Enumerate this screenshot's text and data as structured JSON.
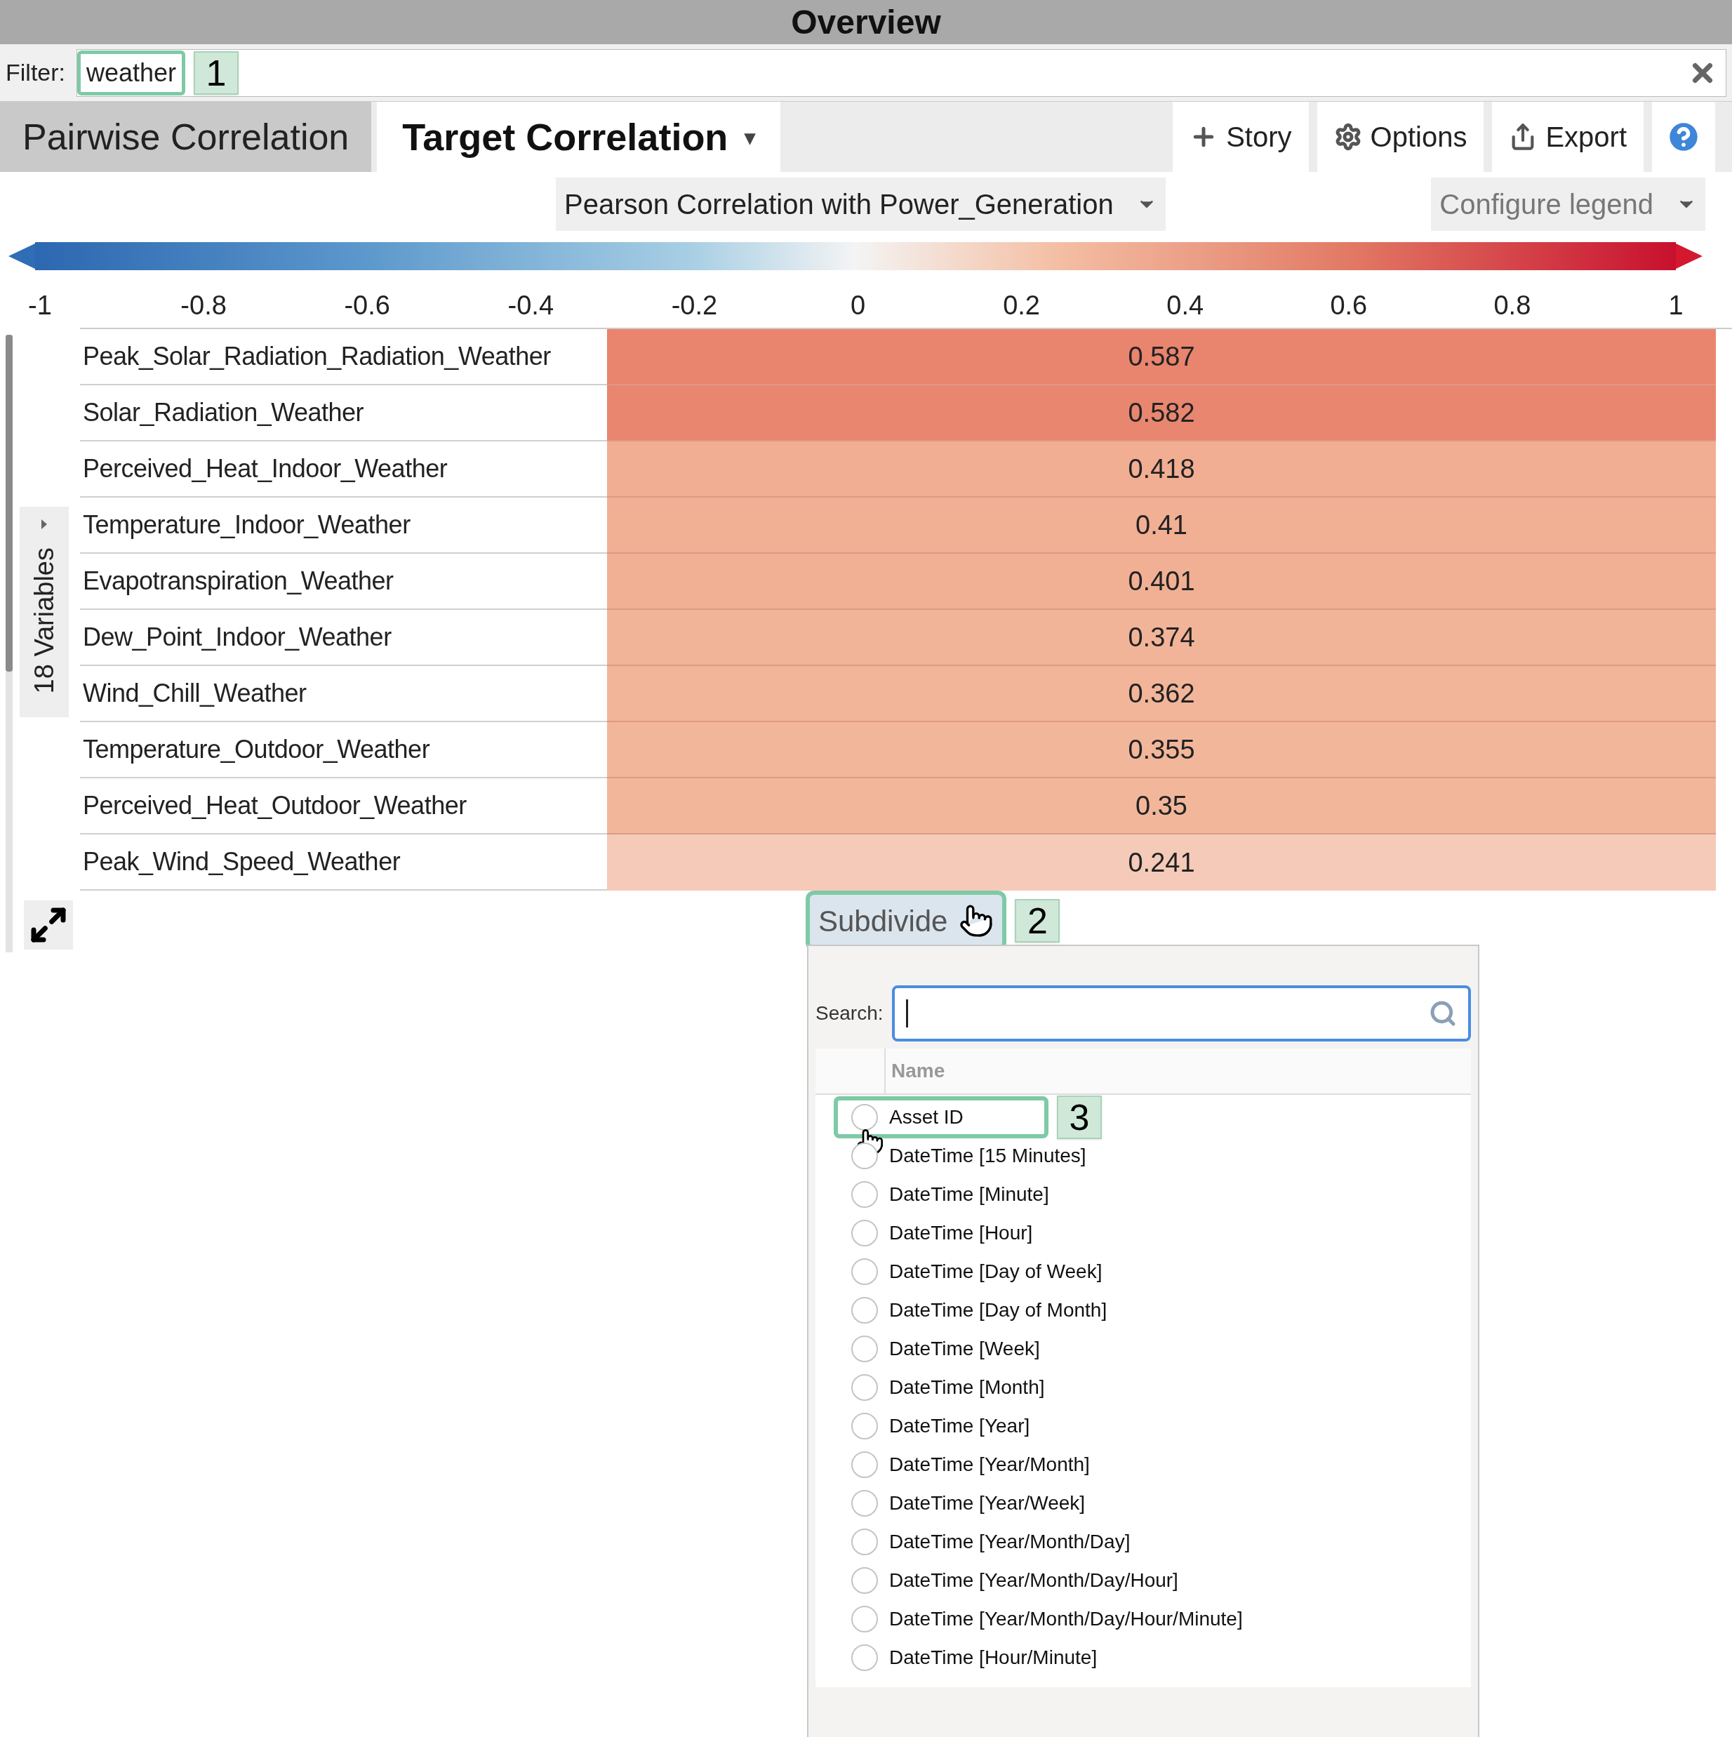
{
  "window": {
    "title": "Overview"
  },
  "filter": {
    "label": "Filter:",
    "value": "weather",
    "callout": "1"
  },
  "tabs": [
    {
      "label": "Pairwise Correlation",
      "selected": false
    },
    {
      "label": "Target Correlation",
      "selected": true,
      "caret": "▾"
    }
  ],
  "toolbar": [
    {
      "kind": "story",
      "label": "Story"
    },
    {
      "kind": "options",
      "label": "Options"
    },
    {
      "kind": "export",
      "label": "Export"
    },
    {
      "kind": "help"
    }
  ],
  "measure_dropdown": {
    "label": "Pearson Correlation with Power_Generation"
  },
  "legend_dropdown": {
    "label": "Configure legend"
  },
  "legend": {
    "ticks": [
      "-1",
      "-0.8",
      "-0.6",
      "-0.4",
      "-0.2",
      "0",
      "0.2",
      "0.4",
      "0.6",
      "0.8",
      "1"
    ]
  },
  "side_panel": {
    "label": "18 Variables"
  },
  "rows": [
    {
      "name": "Peak_Solar_Radiation_Radiation_Weather",
      "value": "0.587",
      "color": "#e9846e"
    },
    {
      "name": "Solar_Radiation_Weather",
      "value": "0.582",
      "color": "#e9866f"
    },
    {
      "name": "Perceived_Heat_Indoor_Weather",
      "value": "0.418",
      "color": "#f1ae92"
    },
    {
      "name": "Temperature_Indoor_Weather",
      "value": "0.41",
      "color": "#f1af93"
    },
    {
      "name": "Evapotranspiration_Weather",
      "value": "0.401",
      "color": "#f1b094"
    },
    {
      "name": "Dew_Point_Indoor_Weather",
      "value": "0.374",
      "color": "#f2b498"
    },
    {
      "name": "Wind_Chill_Weather",
      "value": "0.362",
      "color": "#f2b599"
    },
    {
      "name": "Temperature_Outdoor_Weather",
      "value": "0.355",
      "color": "#f2b69a"
    },
    {
      "name": "Perceived_Heat_Outdoor_Weather",
      "value": "0.35",
      "color": "#f2b79b"
    },
    {
      "name": "Peak_Wind_Speed_Weather",
      "value": "0.241",
      "color": "#f5cab8"
    }
  ],
  "subdivide": {
    "label": "Subdivide",
    "callout": "2"
  },
  "popup": {
    "search_label": "Search:",
    "column": "Name",
    "items": [
      {
        "label": "Asset ID",
        "selected": false,
        "callout": "3"
      },
      {
        "label": "DateTime [15 Minutes]",
        "selected": false
      },
      {
        "label": "DateTime [Minute]",
        "selected": false
      },
      {
        "label": "DateTime [Hour]",
        "selected": false
      },
      {
        "label": "DateTime [Day of Week]",
        "selected": false
      },
      {
        "label": "DateTime [Day of Month]",
        "selected": false
      },
      {
        "label": "DateTime [Week]",
        "selected": false
      },
      {
        "label": "DateTime [Month]",
        "selected": false
      },
      {
        "label": "DateTime [Year]",
        "selected": false
      },
      {
        "label": "DateTime [Year/Month]",
        "selected": false
      },
      {
        "label": "DateTime [Year/Week]",
        "selected": false
      },
      {
        "label": "DateTime [Year/Month/Day]",
        "selected": false
      },
      {
        "label": "DateTime [Year/Month/Day/Hour]",
        "selected": false
      },
      {
        "label": "DateTime [Year/Month/Day/Hour/Minute]",
        "selected": false
      },
      {
        "label": "DateTime [Hour/Minute]",
        "selected": false
      }
    ]
  }
}
